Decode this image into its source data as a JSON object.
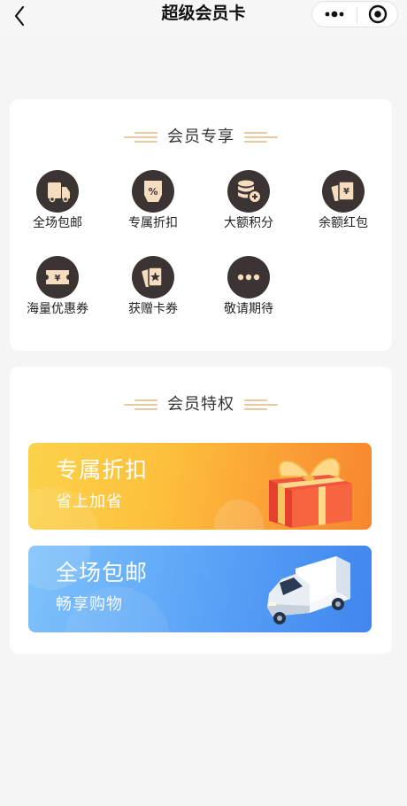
{
  "nav": {
    "title": "超级会员卡"
  },
  "exclusive": {
    "title": "会员专享",
    "items": [
      {
        "label": "全场包邮",
        "icon": "truck-icon"
      },
      {
        "label": "专属折扣",
        "icon": "percent-tag-icon"
      },
      {
        "label": "大额积分",
        "icon": "coin-stack-icon"
      },
      {
        "label": "余额红包",
        "icon": "red-envelope-icon"
      },
      {
        "label": "海量优惠券",
        "icon": "coupon-icon"
      },
      {
        "label": "获赠卡券",
        "icon": "gift-ticket-icon"
      },
      {
        "label": "敬请期待",
        "icon": "more-dots-icon"
      }
    ]
  },
  "privilege": {
    "title": "会员特权",
    "banners": [
      {
        "title": "专属折扣",
        "subtitle": "省上加省",
        "art": "gift-box-icon"
      },
      {
        "title": "全场包邮",
        "subtitle": "畅享购物",
        "art": "delivery-van-icon"
      }
    ]
  },
  "colors": {
    "icon_bg": "#3b3433",
    "icon_accent": "#f6ddc0",
    "discount_banner": "#fbb63f",
    "shipping_banner": "#5aa2f6",
    "title_decoration": "#e8c9a2"
  }
}
